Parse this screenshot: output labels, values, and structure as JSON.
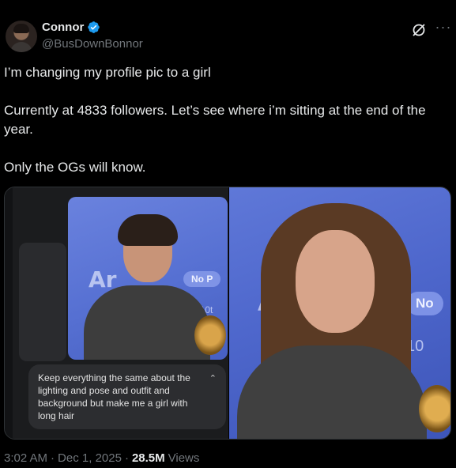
{
  "author": {
    "display_name": "Connor",
    "handle": "@BusDownBonnor",
    "verified": true,
    "verified_color": "#1d9bf0"
  },
  "header_actions": {
    "grok_icon": "grok-icon",
    "more_icon": "more-icon",
    "more_label": "···"
  },
  "tweet": {
    "text": "I’m changing my profile pic to a girl\n\nCurrently at 4833 followers. Let’s see where i’m sitting at the end of the year.\n\nOnly the OGs will know."
  },
  "media": {
    "left": {
      "sign_text": "Ar",
      "pill_text": "No P",
      "sub_text": "ng 10t",
      "prompt": "Keep everything the same about the lighting and pose and outfit and background but make me a girl with long hair",
      "chevron_icon": "chevron-up-icon"
    },
    "right": {
      "sign_text": "A",
      "pill_text": "No",
      "sub_text": "10"
    }
  },
  "meta": {
    "time": "3:02 AM",
    "separator": "·",
    "date": "Dec 1, 2025",
    "views_count": "28.5M",
    "views_label": "Views"
  }
}
